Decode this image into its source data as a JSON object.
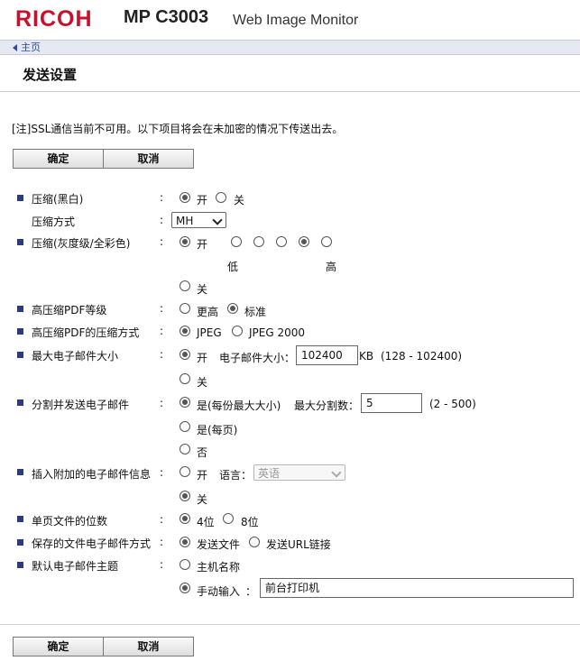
{
  "header": {
    "brand": "RICOH",
    "model": "MP C3003",
    "product": "Web Image Monitor"
  },
  "nav": {
    "home": "主页"
  },
  "page": {
    "title": "发送设置",
    "note": "[注]SSL通信当前不可用。以下项目将会在未加密的情况下传送出去。"
  },
  "buttons": {
    "ok": "确定",
    "cancel": "取消"
  },
  "colon": ":",
  "settings": {
    "compress_bw": {
      "label": "压缩(黑白)",
      "on": "开",
      "off": "关",
      "selected": "on"
    },
    "compress_method": {
      "label": "压缩方式",
      "value": "MH"
    },
    "compress_color": {
      "label": "压缩(灰度级/全彩色)",
      "on": "开",
      "low": "低",
      "high": "高",
      "off": "关",
      "selected": "on",
      "level_selected": 4,
      "level_count": 5
    },
    "pdf_level": {
      "label": "高压缩PDF等级",
      "higher": "更高",
      "standard": "标准",
      "selected": "standard"
    },
    "pdf_method": {
      "label": "高压缩PDF的压缩方式",
      "jpeg": "JPEG",
      "jpeg2000": "JPEG 2000",
      "selected": "jpeg"
    },
    "max_email": {
      "label": "最大电子邮件大小",
      "on": "开",
      "size_label": "电子邮件大小：",
      "size_value": "102400",
      "unit": "KB",
      "range": "(128 - 102400)",
      "off": "关",
      "selected": "on"
    },
    "split": {
      "label": "分割并发送电子邮件",
      "opt1": "是(每份最大大小)",
      "max_label": "最大分割数：",
      "max_value": "5",
      "range": "(2 - 500)",
      "opt2": "是(每页)",
      "opt3": "否",
      "selected": "opt1"
    },
    "insert_info": {
      "label": "插入附加的电子邮件信息",
      "on": "开",
      "lang_label": "语言：",
      "lang_value": "英语",
      "off": "关",
      "selected": "off"
    },
    "digits": {
      "label": "单页文件的位数",
      "opt4": "4位",
      "opt8": "8位",
      "selected": "4"
    },
    "save_method": {
      "label": "保存的文件电子邮件方式",
      "send_file": "发送文件",
      "send_url": "发送URL链接",
      "selected": "send_file"
    },
    "subject": {
      "label": "默认电子邮件主题",
      "hostname": "主机名称",
      "manual": "手动输入",
      "manual_colon": "：",
      "manual_value": "前台打印机",
      "selected": "manual"
    }
  },
  "colors": {
    "brand_red": "#c8102e",
    "bullet": "#2a3a86",
    "link": "#2b4a9b"
  }
}
